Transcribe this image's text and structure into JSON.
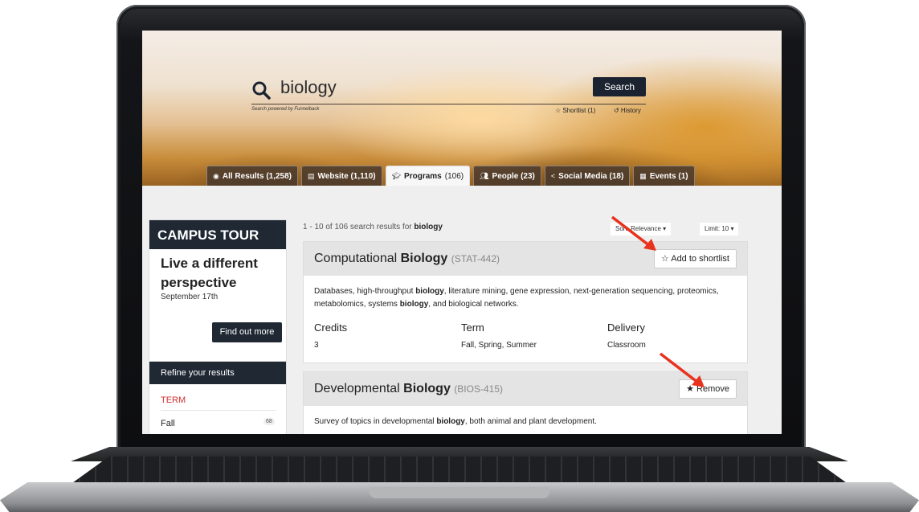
{
  "search": {
    "query": "biology",
    "button": "Search",
    "powered": "Search powered by Funnelback",
    "shortlist": "☆ Shortlist (1)",
    "history": "↺ History"
  },
  "tabs": [
    {
      "icon": "globe-icon",
      "label": "All Results (1,258)"
    },
    {
      "icon": "document-icon",
      "label": "Website (1,110)"
    },
    {
      "icon": "graduation-cap-icon",
      "label": "Programs",
      "count": "(106)"
    },
    {
      "icon": "people-icon",
      "label": "People (23)"
    },
    {
      "icon": "share-icon",
      "label": "Social Media (18)"
    },
    {
      "icon": "calendar-icon",
      "label": "Events (1)"
    }
  ],
  "tour": {
    "heading": "CAMPUS TOUR",
    "title": "Live a different perspective",
    "date": "September 17th",
    "button": "Find out more"
  },
  "refine": {
    "heading": "Refine your results",
    "term": "TERM",
    "fall": "Fall",
    "fall_count": "68"
  },
  "results": {
    "summary_prefix": "1 - 10 of 106 search results for ",
    "query": "biology",
    "sort": "Sort: Relevance ▾",
    "limit": "Limit: 10 ▾"
  },
  "card1": {
    "title_pre": "Computational ",
    "title_bold": "Biology",
    "code": "(STAT-442)",
    "button": "☆ Add to shortlist",
    "desc_a": "Databases, high-throughput ",
    "desc_b": "biology",
    "desc_c": ", literature mining, gene expression, next-generation sequencing, proteomics, metabolomics, systems ",
    "desc_d": "biology",
    "desc_e": ", and biological networks.",
    "credits_label": "Credits",
    "credits": "3",
    "term_label": "Term",
    "term": "Fall, Spring, Summer",
    "delivery_label": "Delivery",
    "delivery": "Classroom"
  },
  "card2": {
    "title_pre": "Developmental ",
    "title_bold": "Biology",
    "code": "(BIOS-415)",
    "button": "★ Remove",
    "desc_a": "Survey of topics in developmental ",
    "desc_b": "biology",
    "desc_c": ", both animal and plant development."
  },
  "colors": {
    "dark": "#1f2833",
    "accent_red": "#d02e2e",
    "arrow": "#e8321e"
  }
}
